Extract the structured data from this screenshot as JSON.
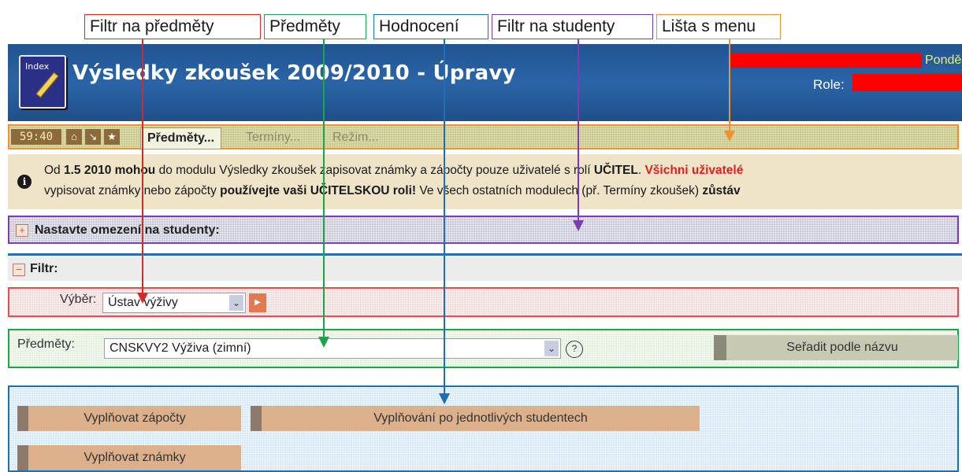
{
  "annotations": {
    "subject_filter": "Filtr na předměty",
    "subjects": "Předměty",
    "grading": "Hodnocení",
    "student_filter": "Filtr na studenty",
    "menu_bar": "Lišta s menu"
  },
  "header": {
    "title": "Výsledky zkoušek 2009/2010 - Úpravy",
    "logo_text": "Index",
    "day_text": "Pondě",
    "role_label": "Role:"
  },
  "menubar": {
    "timer": "59:40",
    "icons": [
      "home-icon",
      "arrow-in-icon",
      "star-icon"
    ],
    "tabs": [
      "Předměty...",
      "Termíny...",
      "Režim..."
    ]
  },
  "info": {
    "icon": "i",
    "line1_a": "Od ",
    "line1_b": "1.5 2010 mohou",
    "line1_c": " do modulu Výsledky zkoušek zapisovat známky a zápočty pouze uživatelé s rolí ",
    "line1_d": "UČITEL",
    "line1_e": ". ",
    "line1_f": "Všichni uživatelé",
    "line2_a": "vypisovat známky nebo zápočty ",
    "line2_b": "používejte vaši UČITELSKOU roli!",
    "line2_c": " Ve všech ostatních modulech (př. Termíny zkoušek) ",
    "line2_d": "zůstáv"
  },
  "student_filter": {
    "toggle": "+",
    "label": "Nastavte omezení na studenty:"
  },
  "filter": {
    "toggle": "−",
    "label": "Filtr:"
  },
  "selection": {
    "label": "Výběr:",
    "value": "Ústav výživy"
  },
  "subjects": {
    "label": "Předměty:",
    "value": "CNSKVY2 Výživa (zimní)",
    "sort_button": "Seřadit podle názvu"
  },
  "grading": {
    "fill_credits": "Vyplňovat zápočty",
    "fill_per_student": "Vyplňování po jednotlivých studentech",
    "fill_grades": "Vyplňovat známky"
  },
  "colors": {
    "subject_filter": "#d62828",
    "subjects": "#1da34a",
    "grading": "#1f6fb2",
    "student_filter": "#7a3bb5",
    "menu_bar": "#f0922e"
  }
}
